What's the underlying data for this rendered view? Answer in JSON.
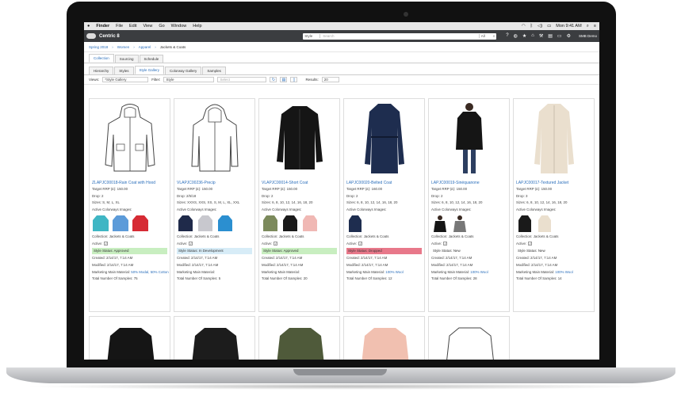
{
  "mac": {
    "apple": "",
    "finder": "Finder",
    "menus": [
      "File",
      "Edit",
      "View",
      "Go",
      "Window",
      "Help"
    ],
    "time": "Mon 9:41 AM"
  },
  "app": {
    "name": "Centric 8",
    "search_scope": "Style",
    "search_placeholder": "Search",
    "search_in": "All",
    "user": "SMB Demo"
  },
  "breadcrumb": [
    "Spring 2018",
    "Women",
    "Apparel",
    "Jackets & Coats"
  ],
  "tabs1": [
    "Collection",
    "Sourcing",
    "Schedule"
  ],
  "tabs2": [
    "Hierarchy",
    "Styles",
    "Style Gallery",
    "Colorway Gallery",
    "Samples"
  ],
  "toolbar": {
    "views_label": "Views:",
    "views_value": "*Style Gallery",
    "filter_label": "Filter:",
    "filter_value": "Style",
    "select_value": "Select",
    "results_label": "Results:",
    "results_value": "20"
  },
  "cards": [
    {
      "title": "ZLAPJC00018-Rain Coat with Hood",
      "rrp": "Target RRP (£): 150.00",
      "drop": "Drop: 2",
      "sizes": "Sizes: S, M, L, XL",
      "colorways_label": "Active Colorways Images:",
      "collection": "Collection: Jackets & Coats",
      "active": "Active:",
      "status": "Style Status: Approved",
      "created": "Created: 2/14/17, 7:14 AM",
      "modified": "Modified: 2/14/17, 7:14 AM",
      "material": "Marketing Main Material: ",
      "material_link": "50% Modal, 50% Cotton",
      "samples": "Total Number Of Samples: 75"
    },
    {
      "title": "VLAPJC00236-Precip",
      "rrp": "Target RRP (£): 150.00",
      "drop": "Drop: 2/5/18",
      "sizes": "Sizes: XXXS, XXS, XS, S, M, L, XL, XXL",
      "colorways_label": "Active Colorways Images:",
      "collection": "Collection: Jackets & Coats",
      "active": "Active:",
      "status": "Style Status: In Development",
      "created": "Created: 2/14/17, 7:14 AM",
      "modified": "Modified: 2/14/17, 7:14 AM",
      "material": "Marketing Main Material:",
      "material_link": "",
      "samples": "Total Number Of Samples: 5"
    },
    {
      "title": "VLAPJC00014-Short Coat",
      "rrp": "Target RRP (£): 150.00",
      "drop": "Drop: 2",
      "sizes": "Sizes: 6, 8, 10, 12, 14, 16, 18, 20",
      "colorways_label": "Active Colorways Images:",
      "collection": "Collection: Jackets & Coats",
      "active": "Active:",
      "status": "Style Status: Approved",
      "created": "Created: 2/14/17, 7:14 AM",
      "modified": "Modified: 2/14/17, 7:14 AM",
      "material": "Marketing Main Material:",
      "material_link": "",
      "samples": "Total Number Of Samples: 20"
    },
    {
      "title": "LAPJC00020-Belted Coat",
      "rrp": "Target RRP (£): 160.00",
      "drop": "Drop: 2",
      "sizes": "Sizes: 6, 8, 10, 12, 14, 16, 18, 20",
      "colorways_label": "Active Colorways Images:",
      "collection": "Collection: Jackets & Coats",
      "active": "Active:",
      "status": "Style Status: Dropped",
      "created": "Created: 2/14/17, 7:14 AM",
      "modified": "Modified: 2/14/17, 7:14 AM",
      "material": "Marketing Main Material: ",
      "material_link": "100% Wool",
      "samples": "Total Number Of Samples: 12"
    },
    {
      "title": "LAPJC00019-Sinéquanone",
      "rrp": "Target RRP (£): 150.00",
      "drop": "Drop: 2",
      "sizes": "Sizes: 6, 8, 10, 12, 14, 16, 18, 20",
      "colorways_label": "Active Colorways Images:",
      "collection": "Collection: Jackets & Coats",
      "active": "Active:",
      "status": "Style Status: New",
      "created": "Created: 2/14/17, 7:14 AM",
      "modified": "Modified: 2/14/17, 7:14 AM",
      "material": "Marketing Main Material: ",
      "material_link": "100% Wool",
      "samples": "Total Number Of Samples: 28"
    },
    {
      "title": "LAPJC00017-Textured Jacket",
      "rrp": "Target RRP (£): 150.00",
      "drop": "Drop: 3",
      "sizes": "Sizes: 6, 8, 10, 12, 14, 16, 18, 20",
      "colorways_label": "Active Colorways Images:",
      "collection": "Collection: Jackets & Coats",
      "active": "Active:",
      "status": "Style Status: New",
      "created": "Created: 2/14/17, 7:14 AM",
      "modified": "Modified: 2/14/17, 7:14 AM",
      "material": "Marketing Main Material: ",
      "material_link": "100% Wool",
      "samples": "Total Number Of Samples: 14"
    }
  ],
  "colors": {
    "accent": "#2a6ebb",
    "approved": "#c8eec0",
    "dev": "#d7ecf7",
    "dropped": "#e8788a"
  }
}
